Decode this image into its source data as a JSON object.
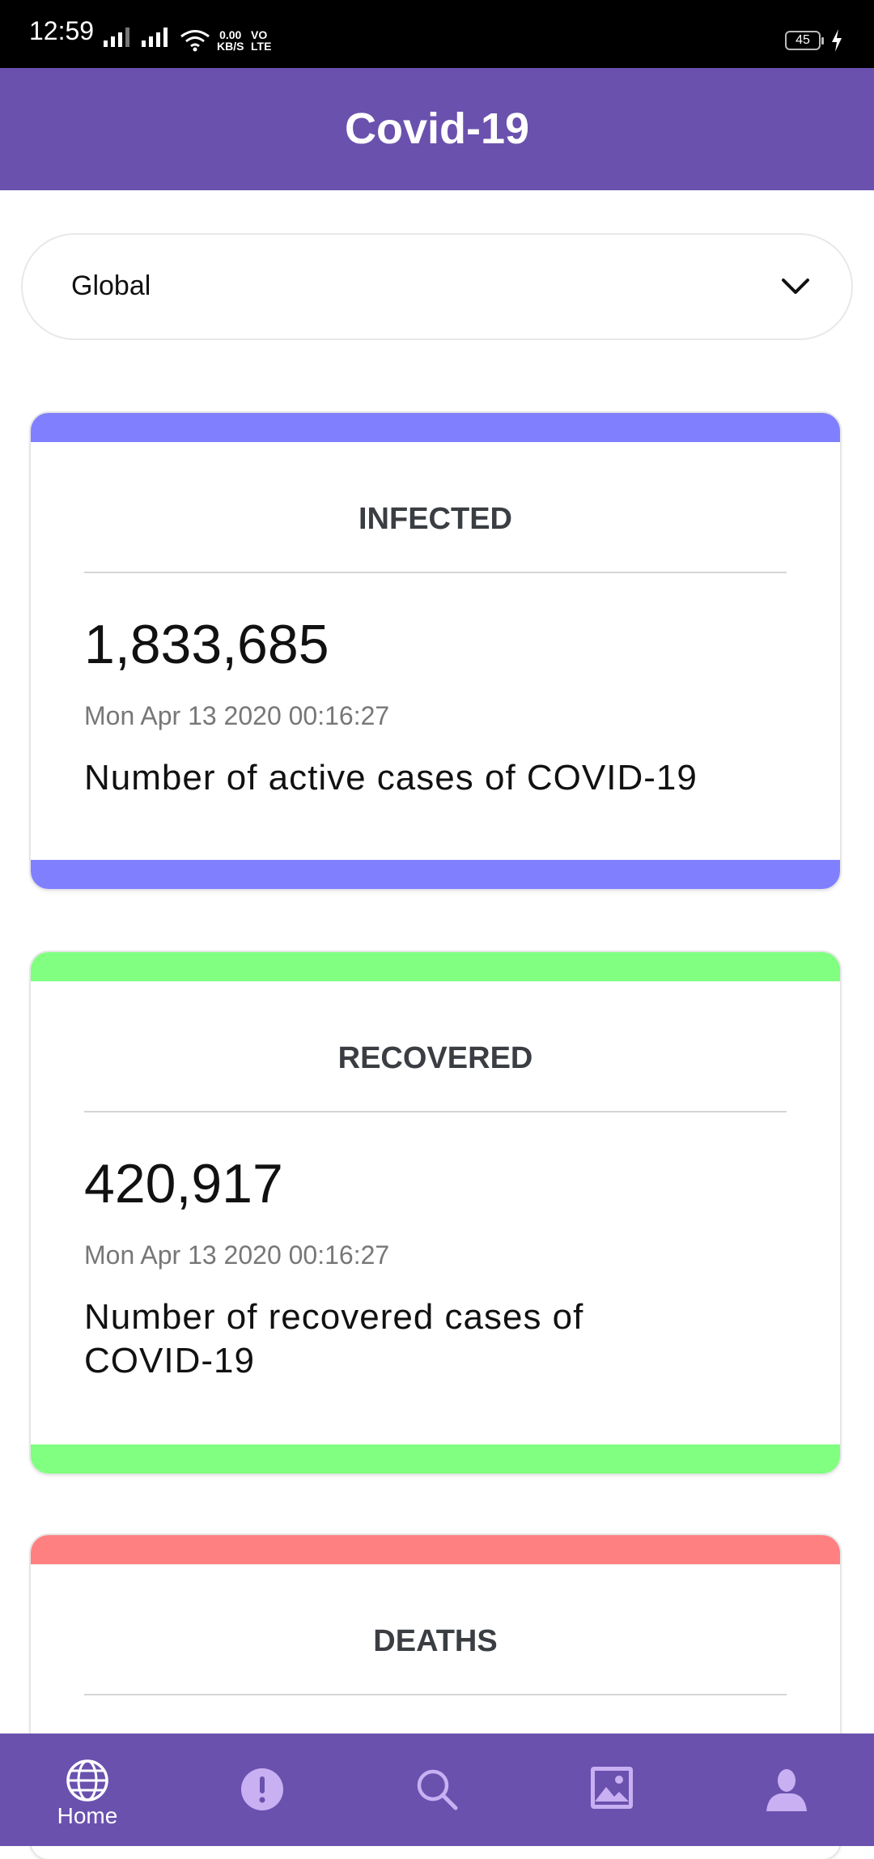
{
  "status_bar": {
    "time": "12:59",
    "net_speed_value": "0.00",
    "net_speed_unit": "KB/S",
    "volte_top": "VO",
    "volte_bottom": "LTE",
    "battery": "45"
  },
  "app_bar": {
    "title": "Covid-19"
  },
  "selector": {
    "value": "Global",
    "icon": "chevron-down-icon"
  },
  "cards": [
    {
      "heading": "INFECTED",
      "count": "1,833,685",
      "timestamp": "Mon Apr 13 2020 00:16:27",
      "description": "Number of active cases of COVID-19",
      "accent": "#8080ff"
    },
    {
      "heading": "RECOVERED",
      "count": "420,917",
      "timestamp": "Mon Apr 13 2020 00:16:27",
      "description": "Number of recovered cases of COVID-19",
      "accent": "#80ff80"
    },
    {
      "heading": "DEATHS",
      "accent": "#ff8080"
    }
  ],
  "bottom_nav": {
    "items": [
      {
        "icon": "globe-icon",
        "label": "Home",
        "active": true
      },
      {
        "icon": "alert-icon"
      },
      {
        "icon": "search-icon"
      },
      {
        "icon": "image-icon"
      },
      {
        "icon": "user-icon"
      }
    ]
  },
  "colors": {
    "primary": "#6a51ae",
    "icon_inactive": "#c9b0f2"
  }
}
